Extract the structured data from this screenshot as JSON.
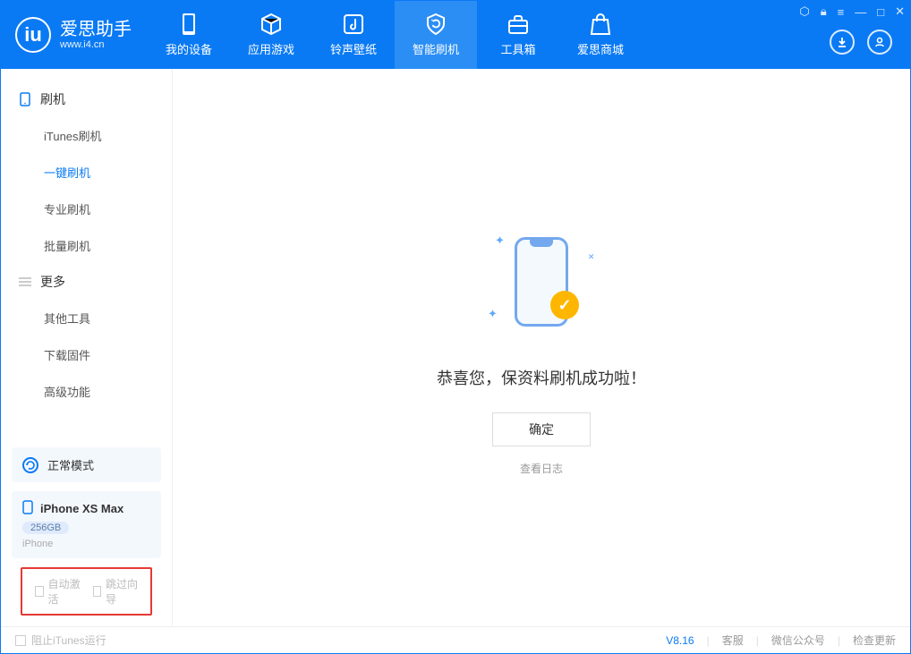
{
  "logo": {
    "title": "爱思助手",
    "subtitle": "www.i4.cn"
  },
  "nav": {
    "items": [
      {
        "label": "我的设备"
      },
      {
        "label": "应用游戏"
      },
      {
        "label": "铃声壁纸"
      },
      {
        "label": "智能刷机"
      },
      {
        "label": "工具箱"
      },
      {
        "label": "爱思商城"
      }
    ]
  },
  "sidebar": {
    "group1": {
      "title": "刷机",
      "items": [
        "iTunes刷机",
        "一键刷机",
        "专业刷机",
        "批量刷机"
      ]
    },
    "group2": {
      "title": "更多",
      "items": [
        "其他工具",
        "下载固件",
        "高级功能"
      ]
    },
    "mode": "正常模式",
    "device": {
      "name": "iPhone XS Max",
      "storage": "256GB",
      "type": "iPhone"
    },
    "checks": {
      "auto_activate": "自动激活",
      "skip_guide": "跳过向导"
    }
  },
  "content": {
    "title": "恭喜您，保资料刷机成功啦！",
    "ok": "确定",
    "log": "查看日志"
  },
  "status": {
    "block_itunes": "阻止iTunes运行",
    "version": "V8.16",
    "links": [
      "客服",
      "微信公众号",
      "检查更新"
    ]
  }
}
